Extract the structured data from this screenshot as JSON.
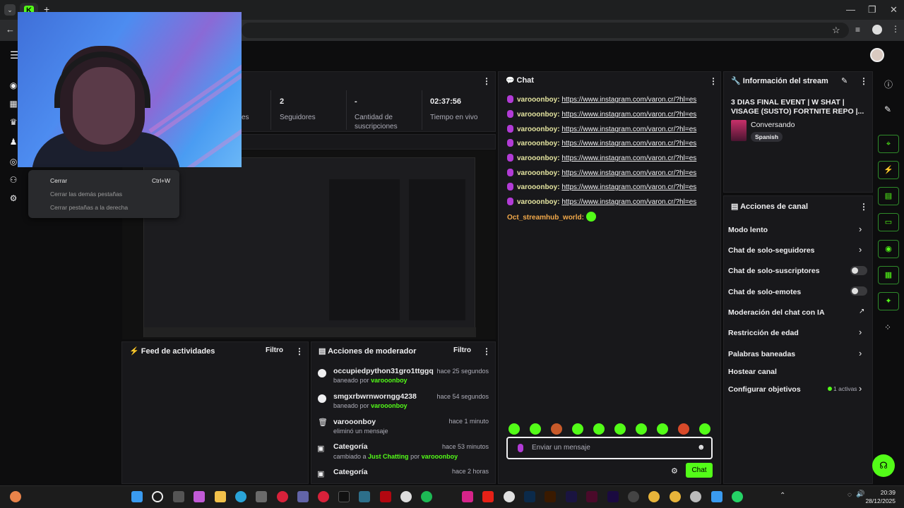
{
  "browser": {
    "new_tab": "+",
    "back": "←",
    "window_controls": [
      "—",
      "❐",
      "✕"
    ]
  },
  "context_menu": {
    "items": [
      {
        "label": "Cerrar",
        "shortcut": "Ctrl+W"
      },
      {
        "label": "Cerrar las demás pestañas",
        "shortcut": ""
      },
      {
        "label": "Cerrar pestañas a la derecha",
        "shortcut": ""
      }
    ]
  },
  "stats": {
    "partial_label": "es",
    "seguidores_value": "2",
    "seguidores_label": "Seguidores",
    "suscripciones_value": "-",
    "suscripciones_label": "Cantidad de suscripciones",
    "tiempo_value": "02:37:56",
    "tiempo_label": "Tiempo en vivo"
  },
  "chat": {
    "title": "Chat",
    "messages": [
      {
        "user": "varooonboy:",
        "text": "https://www.instagram.com/varon.cr/?hl=es"
      },
      {
        "user": "varooonboy:",
        "text": "https://www.instagram.com/varon.cr/?hl=es"
      },
      {
        "user": "varooonboy:",
        "text": "https://www.instagram.com/varon.cr/?hl=es"
      },
      {
        "user": "varooonboy:",
        "text": "https://www.instagram.com/varon.cr/?hl=es"
      },
      {
        "user": "varooonboy:",
        "text": "https://www.instagram.com/varon.cr/?hl=es"
      },
      {
        "user": "varooonboy:",
        "text": "https://www.instagram.com/varon.cr/?hl=es"
      },
      {
        "user": "varooonboy:",
        "text": "https://www.instagram.com/varon.cr/?hl=es"
      },
      {
        "user": "varooonboy:",
        "text": "https://www.instagram.com/varon.cr/?hl=es"
      }
    ],
    "bot_user": "Oct_streamhub_world:",
    "input_placeholder": "Enviar un mensaje",
    "send_label": "Chat"
  },
  "stream_info": {
    "title": "Información del stream",
    "stream_title": "3 DIAS FINAL EVENT | W SHAT | VISAGE (SUSTO) FORTNITE REPO |...",
    "category": "Conversando",
    "language": "Spanish"
  },
  "channel_actions": {
    "title": "Acciones de canal",
    "items": [
      "Modo lento",
      "Chat de solo-seguidores",
      "Chat de solo-suscriptores",
      "Chat de solo-emotes",
      "Moderación del chat con IA",
      "Restricción de edad",
      "Palabras baneadas",
      "Hostear canal",
      "Configurar objetivos"
    ],
    "objectives_badge": "1 activas"
  },
  "activity_feed": {
    "title": "Feed de actividades",
    "filter": "Filtro"
  },
  "mod_actions": {
    "title": "Acciones de moderador",
    "filter": "Filtro",
    "entries": [
      {
        "name": "occupiedpython31gro1ttggq",
        "prefix": "baneado por",
        "actor": "varooonboy",
        "time": "hace 25 segundos"
      },
      {
        "name": "smgxrbwrnworngg4238",
        "prefix": "baneado por",
        "actor": "varooonboy",
        "time": "hace 54 segundos"
      },
      {
        "name": "varooonboy",
        "prefix": "eliminó un mensaje",
        "actor": "",
        "time": "hace 1 minuto"
      },
      {
        "name": "Categoría",
        "prefix": "cambiado a",
        "actor": "Just Chatting",
        "suffix": "por",
        "actor2": "varooonboy",
        "time": "hace 53 minutos"
      },
      {
        "name": "Categoría",
        "prefix": "",
        "actor": "",
        "time": "hace 2 horas"
      }
    ]
  },
  "taskbar": {
    "time": "20:39",
    "date": "28/12/2025"
  },
  "colors": {
    "accent": "#53fc18",
    "panel": "#18181b",
    "background": "#0d0d0e"
  }
}
